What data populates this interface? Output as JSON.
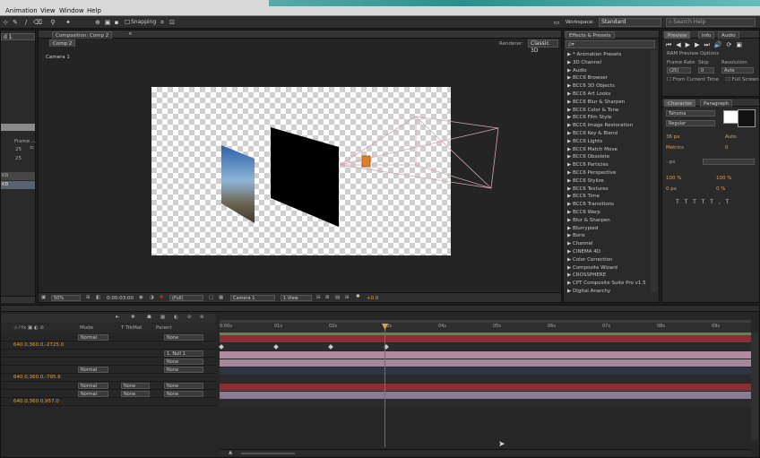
{
  "menu": {
    "items": [
      "Animation",
      "View",
      "Window",
      "Help"
    ]
  },
  "toolbar": {
    "snapping": "Snapping",
    "workspace_label": "Workspace:",
    "workspace_value": "Standard",
    "search_placeholder": "Search Help"
  },
  "project": {
    "col_header": "Frame ...",
    "vals": [
      "25",
      "25"
    ],
    "kb1": "KB",
    "kb2": "KB",
    "top_field": "d 1"
  },
  "composition": {
    "panel_tab": "Composition: Comp 2",
    "sub_tab": "Comp 2",
    "renderer_label": "Renderer:",
    "renderer_value": "Classic 3D",
    "camera_label": "Camera 1",
    "bottom": {
      "zoom": "50%",
      "time": "0:00:03:00",
      "res": "(Full)",
      "camera": "Camera 1",
      "view": "1 View",
      "offset": "+0.0"
    }
  },
  "effects": {
    "tab": "Effects & Presets",
    "search_placeholder": "ρ▾",
    "items": [
      "* Animation Presets",
      "3D Channel",
      "Audio",
      "BCC6 Browser",
      "BCC6 3D Objects",
      "BCC6 Art Looks",
      "BCC6 Blur & Sharpen",
      "BCC6 Color & Tone",
      "BCC6 Film Style",
      "BCC6 Image Restoration",
      "BCC6 Key & Blend",
      "BCC6 Lights",
      "BCC6 Match Move",
      "BCC6 Obsolete",
      "BCC6 Particles",
      "BCC6 Perspective",
      "BCC6 Stylize",
      "BCC6 Textures",
      "BCC6 Time",
      "BCC6 Transitions",
      "BCC6 Warp",
      "Blur & Sharpen",
      "Blurrypied",
      "Boris",
      "Channel",
      "CINEMA 4D",
      "Color Correction",
      "Composite Wizard",
      "CROSSPHERE",
      "CPT Composite Suite Pro v1.5",
      "Digital Anarchy"
    ]
  },
  "preview": {
    "tabs": [
      "Preview",
      "Info",
      "Audio"
    ],
    "ram_options": "RAM Preview Options",
    "frame_rate_label": "Frame Rate",
    "skip_label": "Skip",
    "resolution_label": "Resolution",
    "frame_rate_value": "(25)",
    "skip_value": "0",
    "resolution_value": "Auto",
    "from_current": "From Current Time",
    "full_screen": "Full Screen"
  },
  "character": {
    "tabs": [
      "Character",
      "Paragraph"
    ],
    "font": "Tahoma",
    "style": "Regular",
    "size": "36 px",
    "leading": "Auto",
    "kerning": "Metrics",
    "tracking": "0",
    "stroke": "- px",
    "vscale": "100 %",
    "hscale": "100 %",
    "baseline": "0 px",
    "tsume": "0 %"
  },
  "timeline": {
    "cols": [
      "Mode",
      "T TrkMat",
      "Parent"
    ],
    "rows": [
      {
        "mode": "Normal",
        "parent": "None"
      },
      {
        "value": "640.0,360.0,-2725.0"
      },
      {
        "parent": "1. Null 1"
      },
      {
        "parent": "None"
      },
      {
        "mode": "Normal",
        "parent": "None"
      },
      {
        "value": "640.0,360.0,-795.6"
      },
      {
        "mode": "Normal",
        "trk": "None",
        "parent": "None"
      },
      {
        "mode": "Normal",
        "trk": "None",
        "parent": "None"
      },
      {
        "value": "640.0,360.0,957.0"
      }
    ],
    "ruler": [
      "0:00s",
      "01s",
      "02s",
      "03s",
      "04s",
      "05s",
      "06s",
      "07s",
      "08s",
      "09s"
    ]
  }
}
